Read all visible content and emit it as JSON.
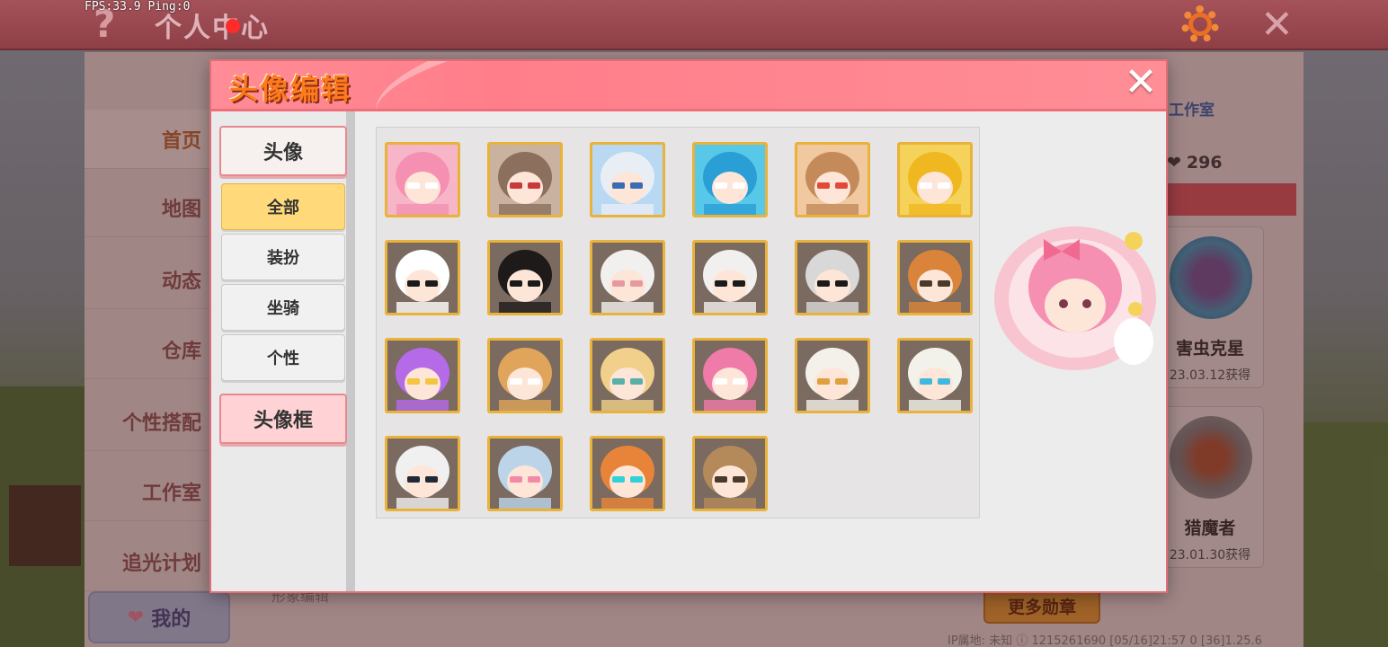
{
  "fps_text": "FPS:33.9  Ping:0",
  "topbar": {
    "title": "个人中心",
    "help_icon": "?",
    "close_icon": "✕"
  },
  "page_sidebar": {
    "items": [
      "首页",
      "地图",
      "动态",
      "仓库",
      "个性搭配",
      "工作室",
      "追光计划"
    ],
    "my_label": "我的"
  },
  "page_right": {
    "studio_link": "工作室",
    "likes": "296",
    "medals": [
      {
        "name": "害虫克星",
        "date": "23.03.12获得"
      },
      {
        "name": "猎魔者",
        "date": "23.01.30获得"
      }
    ],
    "more_medals": "更多勋章",
    "ip_info": "IP属地: 未知 ⓘ   1215261690   [05/16]21:57 0   [36]1.25.6",
    "ghost_label": "形象编辑"
  },
  "modal": {
    "title": "头像编辑",
    "close": "✕",
    "tab_avatar": "头像",
    "tab_frame": "头像框",
    "subtabs": [
      "全部",
      "装扮",
      "坐骑",
      "个性"
    ],
    "selected_subtab": "全部"
  },
  "avatars": [
    {
      "name": "pink-bunny-girl",
      "bg": "#f6b6c8",
      "hair": "#f590b2",
      "accent": "#ffffff"
    },
    {
      "name": "brown-hair-girl",
      "bg": "#c9b3a0",
      "hair": "#8c6f5c",
      "accent": "#c83a3a"
    },
    {
      "name": "white-hair-girl",
      "bg": "#b9d8f2",
      "hair": "#e9eef5",
      "accent": "#3a6bb5"
    },
    {
      "name": "blue-hair-girl",
      "bg": "#58c8e8",
      "hair": "#2a9fd6",
      "accent": "#ffffff"
    },
    {
      "name": "chef-boy",
      "bg": "#f0c9a0",
      "hair": "#c48a5a",
      "accent": "#e04a3a"
    },
    {
      "name": "golden-girl",
      "bg": "#f5d25a",
      "hair": "#f0b820",
      "accent": "#ffffff"
    },
    {
      "name": "white-hair-sunglasses",
      "bg": "#7a6a60",
      "hair": "#ffffff",
      "accent": "#1a1a1a"
    },
    {
      "name": "black-hair-sunglasses",
      "bg": "#7a6a60",
      "hair": "#1e1a1a",
      "accent": "#1a1a1a"
    },
    {
      "name": "pink-cap-glasses",
      "bg": "#7a6a60",
      "hair": "#f2f0ee",
      "accent": "#e69aa0"
    },
    {
      "name": "black-cap-glasses",
      "bg": "#7a6a60",
      "hair": "#f2f0ee",
      "accent": "#1a1a1a"
    },
    {
      "name": "silver-hair-sunglasses",
      "bg": "#7a6a60",
      "hair": "#d8d8d8",
      "accent": "#1a1a1a"
    },
    {
      "name": "ginger-hair-glasses",
      "bg": "#7a6a60",
      "hair": "#d9843a",
      "accent": "#4a3a2a"
    },
    {
      "name": "magic-wand",
      "bg": "#7a6a60",
      "hair": "#b56ae8",
      "accent": "#f5c542"
    },
    {
      "name": "shiba-dog",
      "bg": "#7a6a60",
      "hair": "#e0a45a",
      "accent": "#ffffff"
    },
    {
      "name": "palanquin",
      "bg": "#7a6a60",
      "hair": "#f0d08a",
      "accent": "#5ab0a8"
    },
    {
      "name": "pink-dragon",
      "bg": "#7a6a60",
      "hair": "#f07aa8",
      "accent": "#ffffff"
    },
    {
      "name": "white-swan",
      "bg": "#7a6a60",
      "hair": "#f4f0ea",
      "accent": "#e0a040"
    },
    {
      "name": "unicorn-cow",
      "bg": "#7a6a60",
      "hair": "#f2f2ea",
      "accent": "#3fb8e0"
    },
    {
      "name": "captain-bear",
      "bg": "#7a6a60",
      "hair": "#f0f0f0",
      "accent": "#1e2a3a"
    },
    {
      "name": "pink-elephant",
      "bg": "#7a6a60",
      "hair": "#bcd4e8",
      "accent": "#f08aa8"
    },
    {
      "name": "cyber-fox",
      "bg": "#7a6a60",
      "hair": "#e8843a",
      "accent": "#32d0d8"
    },
    {
      "name": "pilot-rabbit",
      "bg": "#7a6a60",
      "hair": "#b58a5a",
      "accent": "#4a3a2a"
    }
  ],
  "preview": {
    "name": "pink-bunny-girl-large",
    "frame": "#f7c4cf",
    "hair": "#f590b2",
    "bow": "#f06a90"
  },
  "colors": {
    "modal_header": "#ff8c96",
    "selected_subtab": "#ffd97a",
    "avatar_border": "#e9b23a"
  }
}
